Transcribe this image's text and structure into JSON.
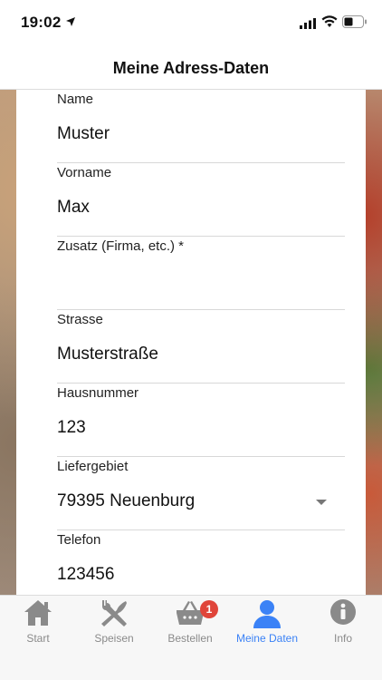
{
  "status_bar": {
    "time": "19:02"
  },
  "nav": {
    "title": "Meine Adress-Daten"
  },
  "form": {
    "fields": [
      {
        "label": "Name",
        "value": "Muster"
      },
      {
        "label": "Vorname",
        "value": "Max"
      },
      {
        "label": "Zusatz (Firma, etc.) *",
        "value": ""
      },
      {
        "label": "Strasse",
        "value": "Musterstraße"
      },
      {
        "label": "Hausnummer",
        "value": "123"
      },
      {
        "label": "Liefergebiet",
        "value": "79395 Neuenburg"
      },
      {
        "label": "Telefon",
        "value": "123456"
      }
    ]
  },
  "tab_bar": {
    "tabs": [
      {
        "label": "Start",
        "icon": "home-icon"
      },
      {
        "label": "Speisen",
        "icon": "fork-knife-icon"
      },
      {
        "label": "Bestellen",
        "icon": "basket-icon",
        "badge": "1"
      },
      {
        "label": "Meine Daten",
        "icon": "person-icon",
        "active": true
      },
      {
        "label": "Info",
        "icon": "info-icon"
      }
    ]
  },
  "colors": {
    "accent": "#3b82f6",
    "inactive": "#8a8a8a",
    "badge": "#e0453a"
  }
}
